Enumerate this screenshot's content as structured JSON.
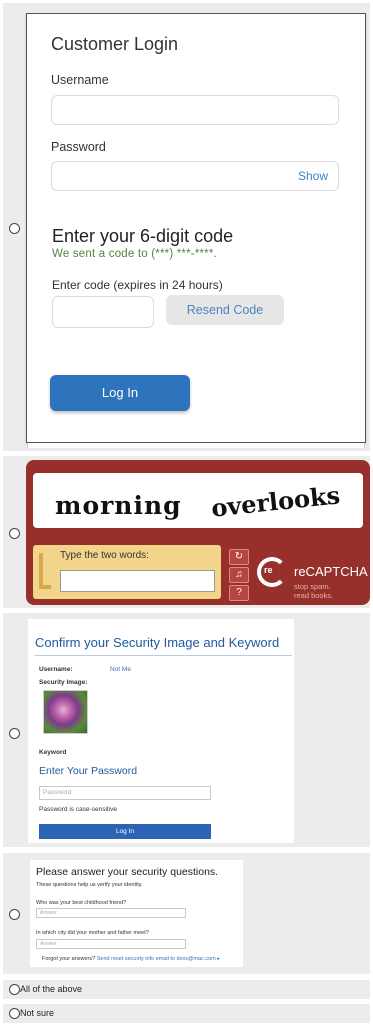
{
  "login": {
    "title": "Customer Login",
    "username_label": "Username",
    "password_label": "Password",
    "show_label": "Show",
    "code_title": "Enter your 6-digit code",
    "code_sent": "We sent a code to (***) ***-****.",
    "code_label": "Enter code (expires in 24 hours)",
    "resend_label": "Resend Code",
    "login_label": "Log In"
  },
  "captcha": {
    "word1": "morning",
    "word2": "overlooks",
    "prompt": "Type the two words:",
    "brand": "reCAPTCHA",
    "tagline_1": "stop spam.",
    "tagline_2": "read books.",
    "refresh_icon": "refresh-icon",
    "audio_icon": "audio-icon",
    "help_icon": "help-icon"
  },
  "security_image": {
    "title": "Confirm your Security Image and Keyword",
    "username_label": "Username:",
    "not_me": "Not Me",
    "image_label": "Security Image:",
    "keyword_label": "Keyword",
    "password_heading": "Enter Your Password",
    "password_placeholder": "Password",
    "case_note": "Password is case-sensitive",
    "login_label": "Log In"
  },
  "questions": {
    "title": "Please answer your security questions.",
    "subtitle": "These questions help us verify your identity.",
    "q1": "Who was your best childhood friend?",
    "q2": "In which city did your mother and father meet?",
    "answer_placeholder": "Answer",
    "forgot_prefix": "Forgot your answers?",
    "forgot_link": "Send reset security info email to dxxx@mac.com"
  },
  "options": {
    "all": "All of the above",
    "not_sure": "Not sure"
  }
}
